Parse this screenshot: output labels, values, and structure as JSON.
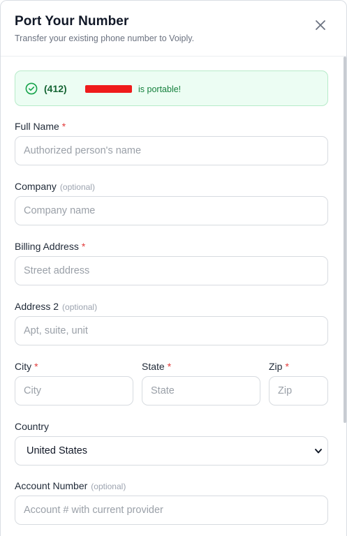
{
  "header": {
    "title": "Port Your Number",
    "subtitle": "Transfer your existing phone number to Voiply."
  },
  "banner": {
    "area_code": "(412)",
    "suffix": "is portable!",
    "status_color": "#ecfdf3"
  },
  "form": {
    "full_name": {
      "label": "Full Name",
      "required": "*",
      "placeholder": "Authorized person's name"
    },
    "company": {
      "label": "Company",
      "optional": "(optional)",
      "placeholder": "Company name"
    },
    "billing_address": {
      "label": "Billing Address",
      "required": "*",
      "placeholder": "Street address"
    },
    "address2": {
      "label": "Address 2",
      "optional": "(optional)",
      "placeholder": "Apt, suite, unit"
    },
    "city": {
      "label": "City",
      "required": "*",
      "placeholder": "City"
    },
    "state": {
      "label": "State",
      "required": "*",
      "placeholder": "State"
    },
    "zip": {
      "label": "Zip",
      "required": "*",
      "placeholder": "Zip"
    },
    "country": {
      "label": "Country",
      "value": "United States"
    },
    "account_number": {
      "label": "Account Number",
      "optional": "(optional)",
      "placeholder": "Account # with current provider"
    }
  },
  "icons": {
    "close": "close-icon",
    "check": "check-circle-icon",
    "chevron": "chevron-down-icon"
  }
}
